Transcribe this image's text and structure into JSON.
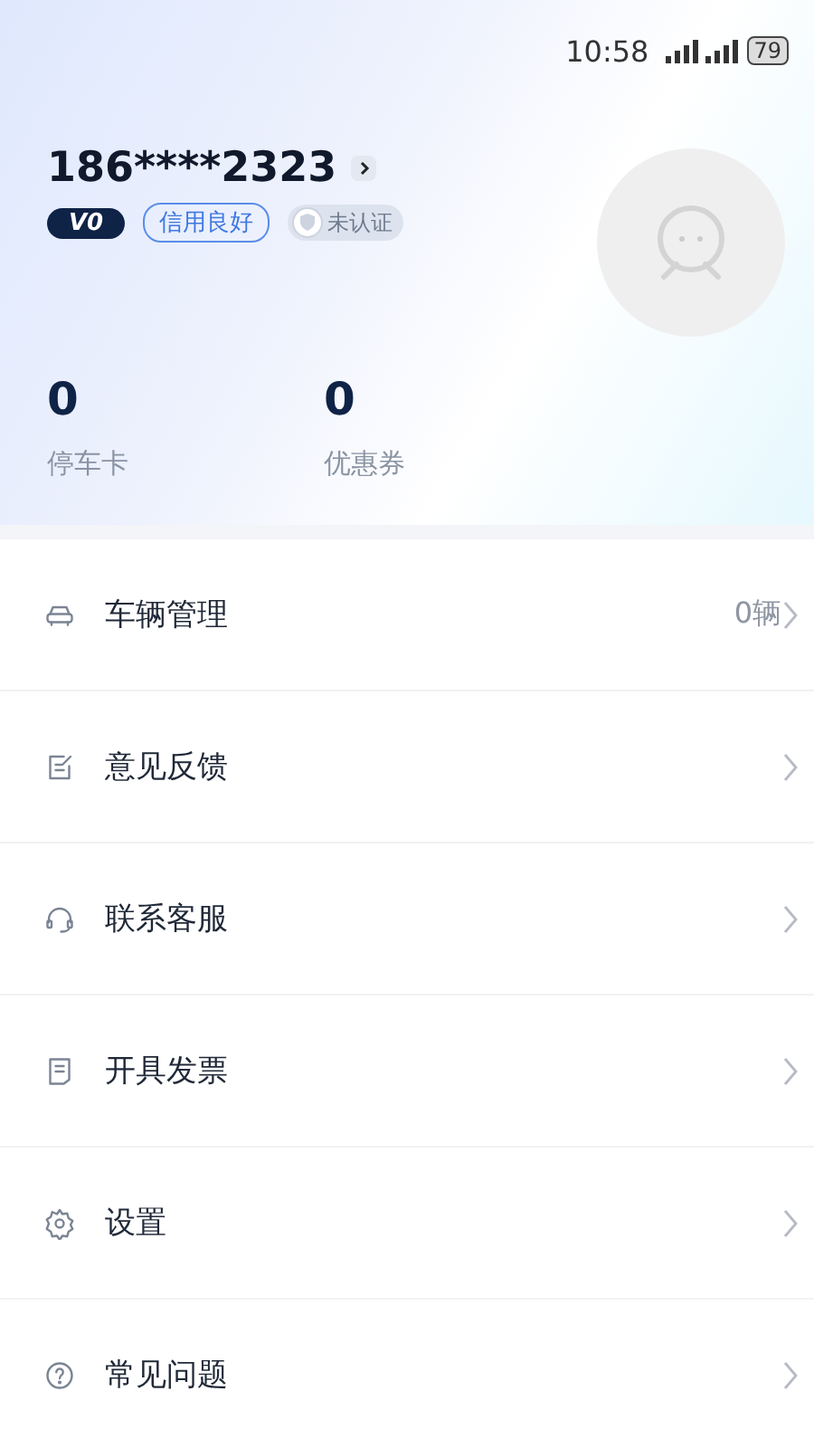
{
  "status_bar": {
    "time": "10:58",
    "battery": "79"
  },
  "profile": {
    "phone": "186****2323",
    "level_badge": "V0",
    "credit_badge": "信用良好",
    "verify_badge": {
      "label": "未认证",
      "verified": false
    }
  },
  "stats": [
    {
      "value": "0",
      "label": "停车卡"
    },
    {
      "value": "0",
      "label": "优惠券"
    }
  ],
  "menu": [
    {
      "label": "车辆管理",
      "value": "0辆"
    },
    {
      "label": "意见反馈"
    },
    {
      "label": "联系客服"
    },
    {
      "label": "开具发票"
    },
    {
      "label": "设置"
    },
    {
      "label": "常见问题"
    }
  ]
}
